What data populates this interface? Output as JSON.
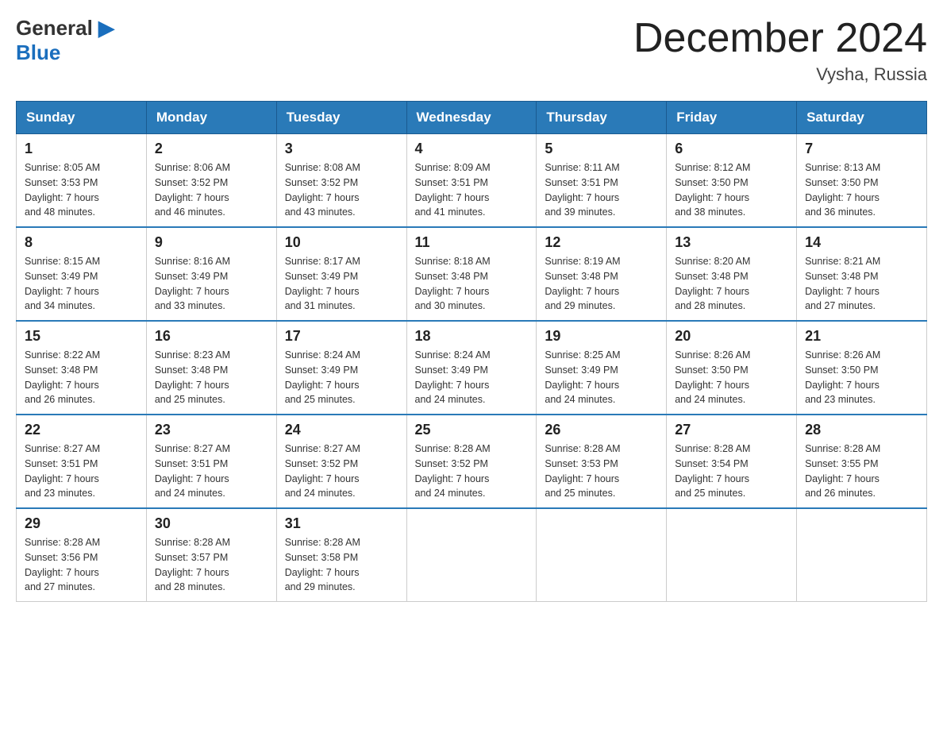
{
  "header": {
    "logo_line1_part1": "General",
    "logo_line1_part2": "Blue",
    "month_title": "December 2024",
    "location": "Vysha, Russia"
  },
  "days_of_week": [
    "Sunday",
    "Monday",
    "Tuesday",
    "Wednesday",
    "Thursday",
    "Friday",
    "Saturday"
  ],
  "weeks": [
    {
      "days": [
        {
          "num": "1",
          "sunrise": "8:05 AM",
          "sunset": "3:53 PM",
          "daylight": "7 hours and 48 minutes."
        },
        {
          "num": "2",
          "sunrise": "8:06 AM",
          "sunset": "3:52 PM",
          "daylight": "7 hours and 46 minutes."
        },
        {
          "num": "3",
          "sunrise": "8:08 AM",
          "sunset": "3:52 PM",
          "daylight": "7 hours and 43 minutes."
        },
        {
          "num": "4",
          "sunrise": "8:09 AM",
          "sunset": "3:51 PM",
          "daylight": "7 hours and 41 minutes."
        },
        {
          "num": "5",
          "sunrise": "8:11 AM",
          "sunset": "3:51 PM",
          "daylight": "7 hours and 39 minutes."
        },
        {
          "num": "6",
          "sunrise": "8:12 AM",
          "sunset": "3:50 PM",
          "daylight": "7 hours and 38 minutes."
        },
        {
          "num": "7",
          "sunrise": "8:13 AM",
          "sunset": "3:50 PM",
          "daylight": "7 hours and 36 minutes."
        }
      ]
    },
    {
      "days": [
        {
          "num": "8",
          "sunrise": "8:15 AM",
          "sunset": "3:49 PM",
          "daylight": "7 hours and 34 minutes."
        },
        {
          "num": "9",
          "sunrise": "8:16 AM",
          "sunset": "3:49 PM",
          "daylight": "7 hours and 33 minutes."
        },
        {
          "num": "10",
          "sunrise": "8:17 AM",
          "sunset": "3:49 PM",
          "daylight": "7 hours and 31 minutes."
        },
        {
          "num": "11",
          "sunrise": "8:18 AM",
          "sunset": "3:48 PM",
          "daylight": "7 hours and 30 minutes."
        },
        {
          "num": "12",
          "sunrise": "8:19 AM",
          "sunset": "3:48 PM",
          "daylight": "7 hours and 29 minutes."
        },
        {
          "num": "13",
          "sunrise": "8:20 AM",
          "sunset": "3:48 PM",
          "daylight": "7 hours and 28 minutes."
        },
        {
          "num": "14",
          "sunrise": "8:21 AM",
          "sunset": "3:48 PM",
          "daylight": "7 hours and 27 minutes."
        }
      ]
    },
    {
      "days": [
        {
          "num": "15",
          "sunrise": "8:22 AM",
          "sunset": "3:48 PM",
          "daylight": "7 hours and 26 minutes."
        },
        {
          "num": "16",
          "sunrise": "8:23 AM",
          "sunset": "3:48 PM",
          "daylight": "7 hours and 25 minutes."
        },
        {
          "num": "17",
          "sunrise": "8:24 AM",
          "sunset": "3:49 PM",
          "daylight": "7 hours and 25 minutes."
        },
        {
          "num": "18",
          "sunrise": "8:24 AM",
          "sunset": "3:49 PM",
          "daylight": "7 hours and 24 minutes."
        },
        {
          "num": "19",
          "sunrise": "8:25 AM",
          "sunset": "3:49 PM",
          "daylight": "7 hours and 24 minutes."
        },
        {
          "num": "20",
          "sunrise": "8:26 AM",
          "sunset": "3:50 PM",
          "daylight": "7 hours and 24 minutes."
        },
        {
          "num": "21",
          "sunrise": "8:26 AM",
          "sunset": "3:50 PM",
          "daylight": "7 hours and 23 minutes."
        }
      ]
    },
    {
      "days": [
        {
          "num": "22",
          "sunrise": "8:27 AM",
          "sunset": "3:51 PM",
          "daylight": "7 hours and 23 minutes."
        },
        {
          "num": "23",
          "sunrise": "8:27 AM",
          "sunset": "3:51 PM",
          "daylight": "7 hours and 24 minutes."
        },
        {
          "num": "24",
          "sunrise": "8:27 AM",
          "sunset": "3:52 PM",
          "daylight": "7 hours and 24 minutes."
        },
        {
          "num": "25",
          "sunrise": "8:28 AM",
          "sunset": "3:52 PM",
          "daylight": "7 hours and 24 minutes."
        },
        {
          "num": "26",
          "sunrise": "8:28 AM",
          "sunset": "3:53 PM",
          "daylight": "7 hours and 25 minutes."
        },
        {
          "num": "27",
          "sunrise": "8:28 AM",
          "sunset": "3:54 PM",
          "daylight": "7 hours and 25 minutes."
        },
        {
          "num": "28",
          "sunrise": "8:28 AM",
          "sunset": "3:55 PM",
          "daylight": "7 hours and 26 minutes."
        }
      ]
    },
    {
      "days": [
        {
          "num": "29",
          "sunrise": "8:28 AM",
          "sunset": "3:56 PM",
          "daylight": "7 hours and 27 minutes."
        },
        {
          "num": "30",
          "sunrise": "8:28 AM",
          "sunset": "3:57 PM",
          "daylight": "7 hours and 28 minutes."
        },
        {
          "num": "31",
          "sunrise": "8:28 AM",
          "sunset": "3:58 PM",
          "daylight": "7 hours and 29 minutes."
        },
        null,
        null,
        null,
        null
      ]
    }
  ],
  "labels": {
    "sunrise": "Sunrise:",
    "sunset": "Sunset:",
    "daylight": "Daylight:"
  }
}
